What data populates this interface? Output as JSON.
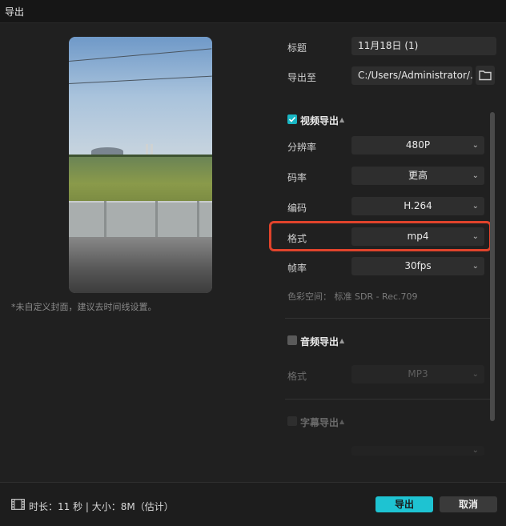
{
  "window": {
    "title": "导出"
  },
  "preview": {
    "note": "*未自定义封面，建议去时间线设置。"
  },
  "form": {
    "title_label": "标题",
    "title_value": "11月18日 (1)",
    "export_to_label": "导出至",
    "export_to_value": "C:/Users/Administrator/...",
    "folder_icon": "folder-icon"
  },
  "video": {
    "section_label": "视频导出",
    "checked": true,
    "resolution_label": "分辨率",
    "resolution_value": "480P",
    "bitrate_label": "码率",
    "bitrate_value": "更高",
    "codec_label": "编码",
    "codec_value": "H.264",
    "format_label": "格式",
    "format_value": "mp4",
    "framerate_label": "帧率",
    "framerate_value": "30fps",
    "colorspace_text": "色彩空间：  标准 SDR - Rec.709"
  },
  "audio": {
    "section_label": "音频导出",
    "checked": false,
    "format_label": "格式",
    "format_value": "MP3"
  },
  "subtitle": {
    "section_label": "字幕导出",
    "checked": false
  },
  "footer": {
    "info": "时长：11 秒 | 大小：8M（估计）",
    "export_button": "导出",
    "cancel_button": "取消"
  },
  "colors": {
    "accent": "#1ec3d2",
    "highlight": "#e0432b"
  }
}
